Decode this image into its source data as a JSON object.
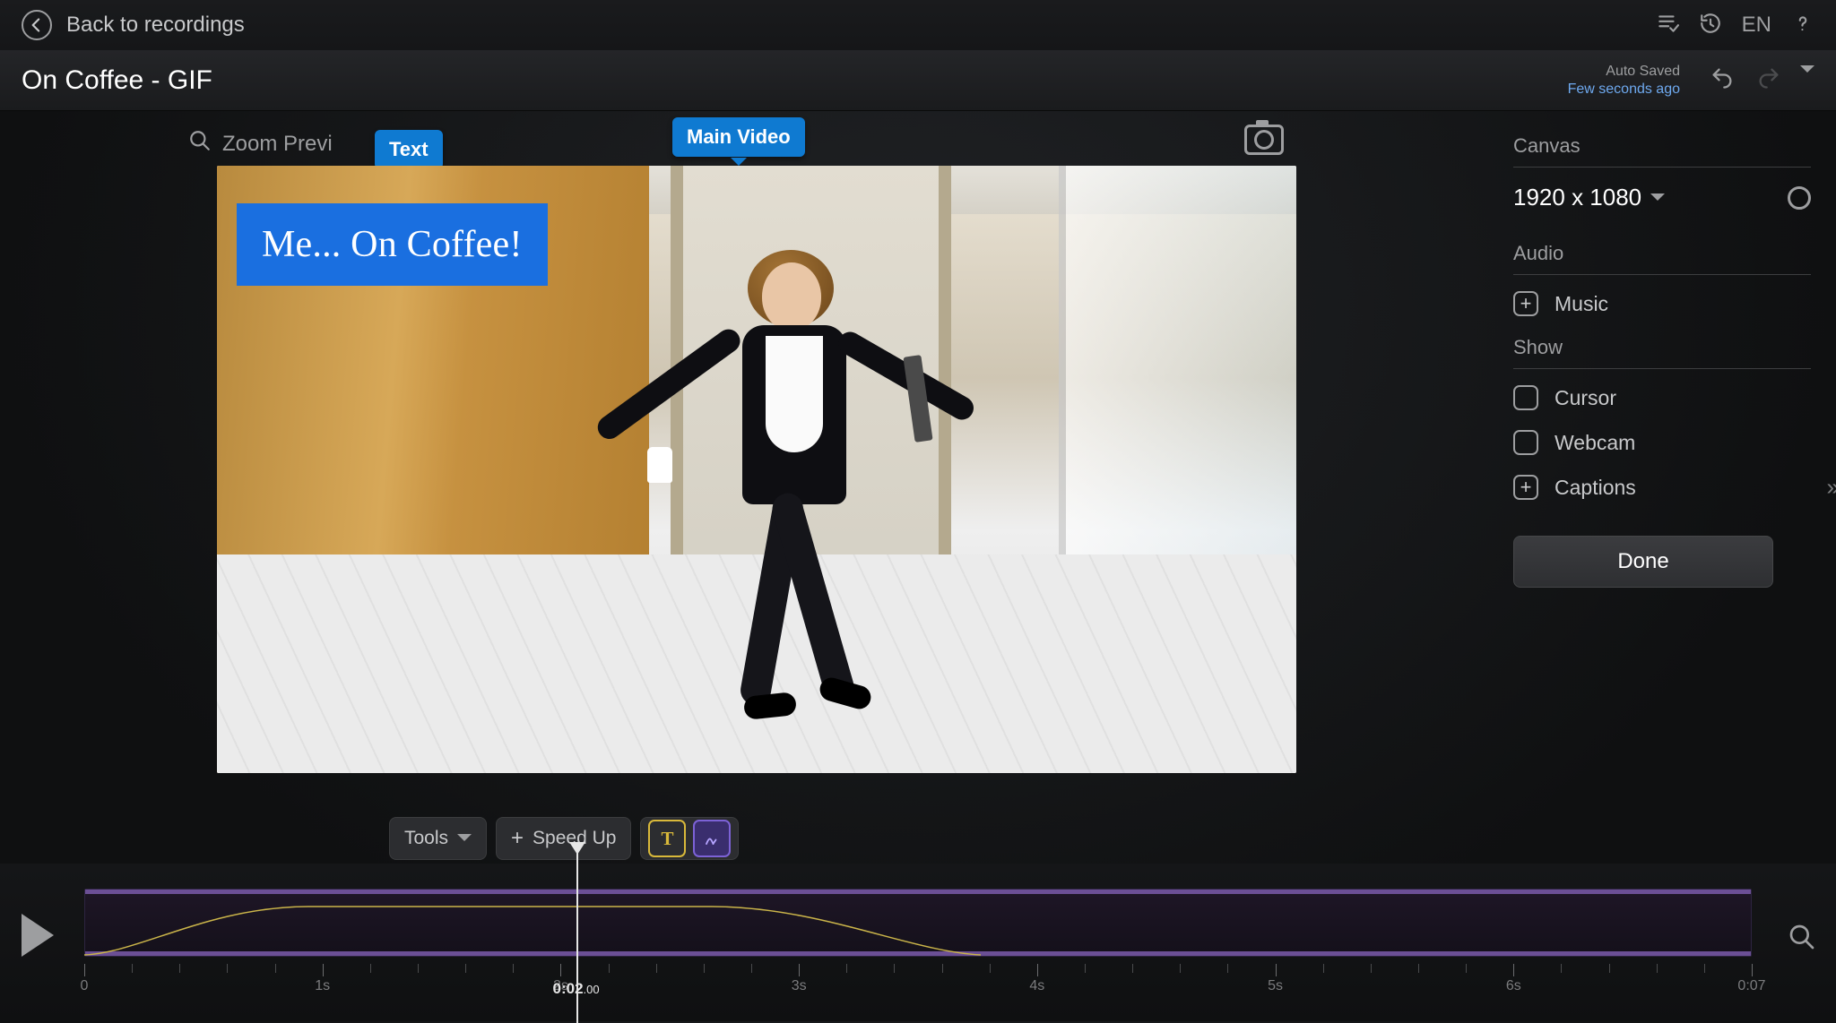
{
  "nav": {
    "back": "Back to recordings",
    "lang": "EN"
  },
  "project": {
    "title": "On Coffee - GIF",
    "autosave_label": "Auto Saved",
    "autosave_time": "Few seconds ago"
  },
  "preview": {
    "zoom_label": "Zoom Previ",
    "tooltip_text": "Text",
    "tooltip_main": "Main Video",
    "caption": "Me... On Coffee!"
  },
  "sidebar": {
    "canvas_header": "Canvas",
    "canvas_value": "1920 x 1080",
    "audio_header": "Audio",
    "audio_music": "Music",
    "show_header": "Show",
    "show_cursor": "Cursor",
    "show_webcam": "Webcam",
    "show_captions": "Captions",
    "done": "Done"
  },
  "tools": {
    "tools_label": "Tools",
    "speed_label": "Speed Up",
    "text_icon": "T"
  },
  "timeline": {
    "playhead_sec": "0:02",
    "playhead_ms": ".00",
    "ticks": [
      "0",
      "1s",
      "2s",
      "3s",
      "4s",
      "5s",
      "6s",
      "0:07"
    ],
    "duration_seconds": 7,
    "playhead_seconds": 2
  }
}
